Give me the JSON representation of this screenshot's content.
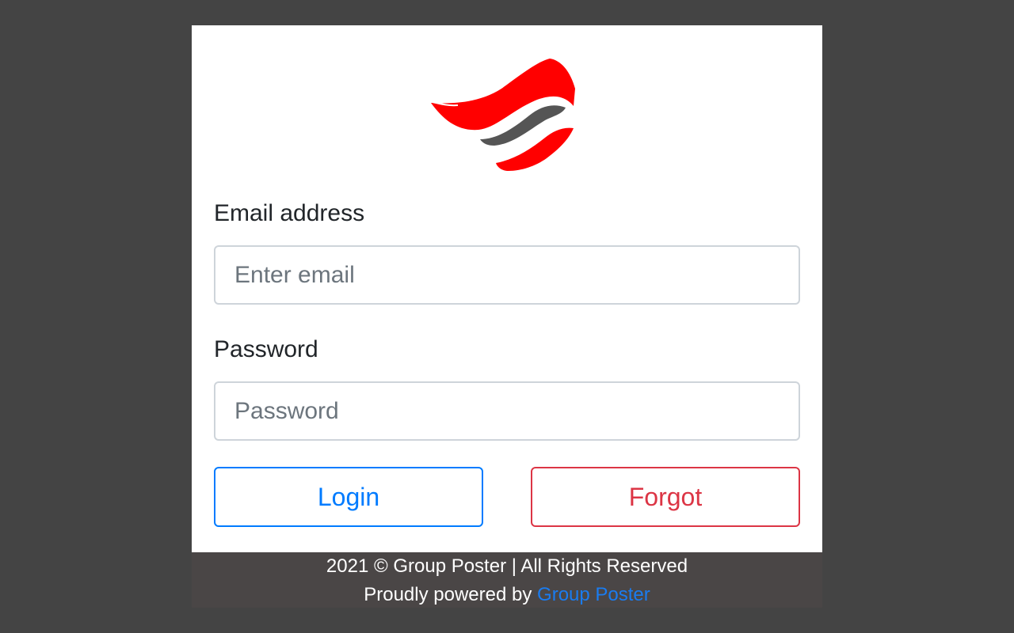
{
  "logo": {
    "icon": "group-poster-logo-icon",
    "colors": {
      "primary": "#ff0000",
      "secondary": "#555555"
    }
  },
  "form": {
    "email_label": "Email address",
    "email_placeholder": "Enter email",
    "email_value": "",
    "password_label": "Password",
    "password_placeholder": "Password",
    "password_value": ""
  },
  "buttons": {
    "login_label": "Login",
    "login_color": "#007bff",
    "forgot_label": "Forgot",
    "forgot_color": "#dc3545"
  },
  "footer": {
    "copyright": "2021 © Group Poster | All Rights Reserved",
    "powered_prefix": "Proudly powered by ",
    "powered_link": "Group Poster"
  }
}
